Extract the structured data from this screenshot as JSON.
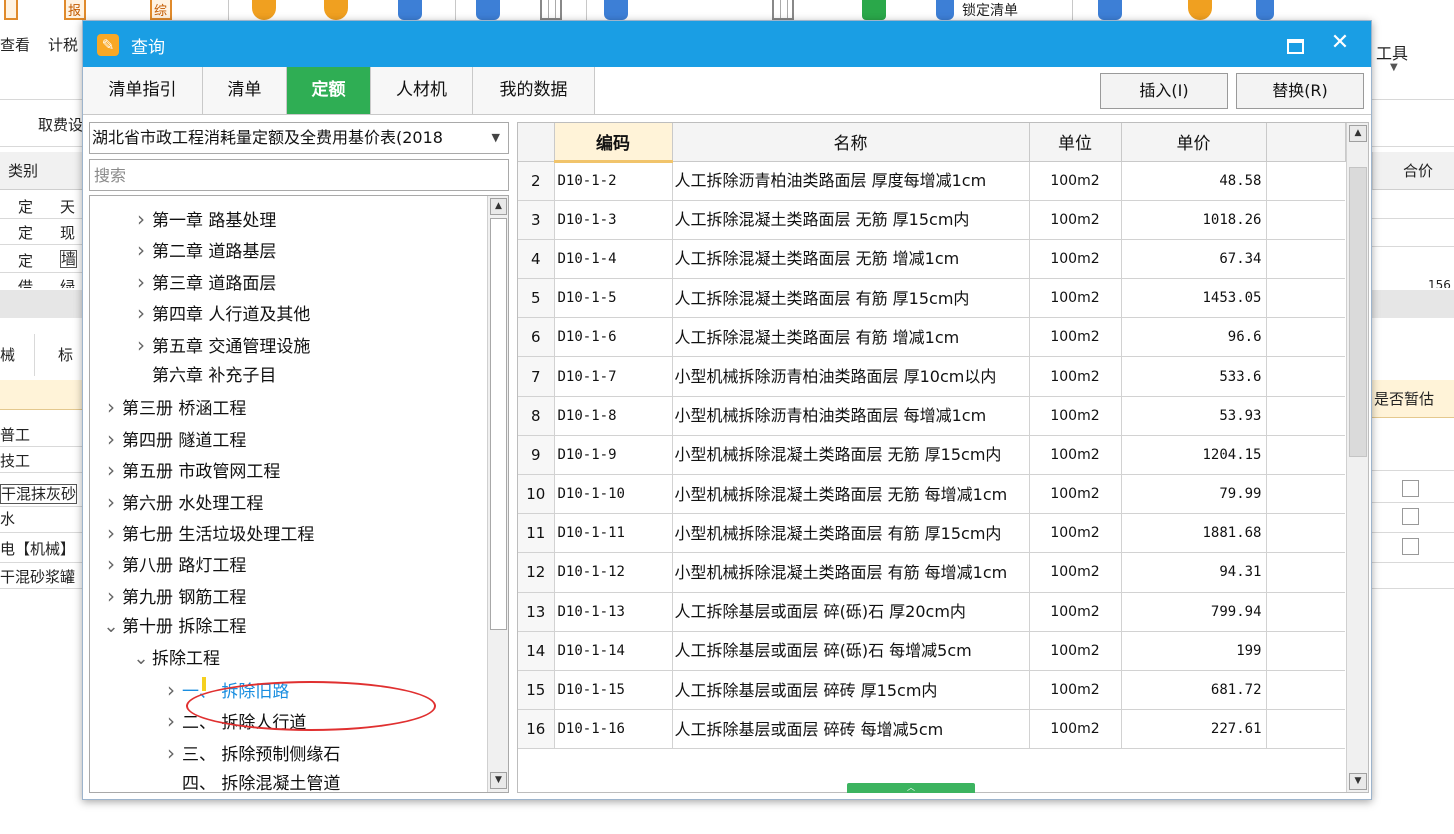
{
  "background": {
    "ribbon_top_texts": [
      "报",
      "综",
      "锁定清单"
    ],
    "ribbon_labels": [
      "查看",
      "计税"
    ],
    "tools_label": "工具",
    "fee_label": "取费设",
    "grid": {
      "category_header": "类别",
      "rows": [
        {
          "type": "定",
          "text": "天"
        },
        {
          "type": "定",
          "text": "现"
        },
        {
          "type": "定",
          "text": "墙"
        },
        {
          "type": "借",
          "text": "绿"
        }
      ],
      "total_header": "合价",
      "partial_value": "156"
    },
    "lower_tabs": [
      "械",
      "标"
    ],
    "resource_rows": [
      "普工",
      "技工",
      "干混抹灰砂",
      "水",
      "电【机械】",
      "干混砂浆罐"
    ],
    "provisional_header": "是否暂估"
  },
  "dialog": {
    "title": "查询",
    "tabs": [
      "清单指引",
      "清单",
      "定额",
      "人材机",
      "我的数据"
    ],
    "active_tab_index": 2,
    "insert_button": "插入(I)",
    "replace_button": "替换(R)",
    "library": "湖北省市政工程消耗量定额及全费用基价表(2018",
    "search_placeholder": "搜索",
    "tree": [
      {
        "label": "第一章 路基处理",
        "level": 1,
        "expander": "collapsed"
      },
      {
        "label": "第二章 道路基层",
        "level": 1,
        "expander": "collapsed"
      },
      {
        "label": "第三章 道路面层",
        "level": 1,
        "expander": "collapsed"
      },
      {
        "label": "第四章 人行道及其他",
        "level": 1,
        "expander": "collapsed"
      },
      {
        "label": "第五章 交通管理设施",
        "level": 1,
        "expander": "collapsed"
      },
      {
        "label": "第六章 补充子目",
        "level": 1,
        "expander": "none"
      },
      {
        "label": "第三册 桥涵工程",
        "level": 0,
        "expander": "collapsed"
      },
      {
        "label": "第四册 隧道工程",
        "level": 0,
        "expander": "collapsed"
      },
      {
        "label": "第五册 市政管网工程",
        "level": 0,
        "expander": "collapsed"
      },
      {
        "label": "第六册 水处理工程",
        "level": 0,
        "expander": "collapsed"
      },
      {
        "label": "第七册 生活垃圾处理工程",
        "level": 0,
        "expander": "collapsed"
      },
      {
        "label": "第八册 路灯工程",
        "level": 0,
        "expander": "collapsed"
      },
      {
        "label": "第九册 钢筋工程",
        "level": 0,
        "expander": "collapsed"
      },
      {
        "label": "第十册 拆除工程",
        "level": 0,
        "expander": "expanded"
      },
      {
        "label": "拆除工程",
        "level": 1,
        "expander": "expanded"
      },
      {
        "label": "一、 拆除旧路",
        "level": 2,
        "expander": "collapsed",
        "selected": true
      },
      {
        "label": "二、 拆除人行道",
        "level": 2,
        "expander": "collapsed"
      },
      {
        "label": "三、 拆除预制侧缘石",
        "level": 2,
        "expander": "collapsed"
      },
      {
        "label": "四、 拆除混凝土管道",
        "level": 2,
        "expander": "none"
      }
    ],
    "table": {
      "headers": {
        "code": "编码",
        "name": "名称",
        "unit": "单位",
        "price": "单价"
      },
      "rows": [
        {
          "no": "2",
          "code": "D10-1-2",
          "name": "人工拆除沥青柏油类路面层 厚度每增减1cm",
          "unit": "100m2",
          "price": "48.58"
        },
        {
          "no": "3",
          "code": "D10-1-3",
          "name": "人工拆除混凝土类路面层 无筋 厚15cm内",
          "unit": "100m2",
          "price": "1018.26"
        },
        {
          "no": "4",
          "code": "D10-1-4",
          "name": "人工拆除混凝土类路面层 无筋 增减1cm",
          "unit": "100m2",
          "price": "67.34"
        },
        {
          "no": "5",
          "code": "D10-1-5",
          "name": "人工拆除混凝土类路面层 有筋 厚15cm内",
          "unit": "100m2",
          "price": "1453.05"
        },
        {
          "no": "6",
          "code": "D10-1-6",
          "name": "人工拆除混凝土类路面层 有筋 增减1cm",
          "unit": "100m2",
          "price": "96.6"
        },
        {
          "no": "7",
          "code": "D10-1-7",
          "name": "小型机械拆除沥青柏油类路面层 厚10cm以内",
          "unit": "100m2",
          "price": "533.6"
        },
        {
          "no": "8",
          "code": "D10-1-8",
          "name": "小型机械拆除沥青柏油类路面层 每增减1cm",
          "unit": "100m2",
          "price": "53.93"
        },
        {
          "no": "9",
          "code": "D10-1-9",
          "name": "小型机械拆除混凝土类路面层 无筋 厚15cm内",
          "unit": "100m2",
          "price": "1204.15"
        },
        {
          "no": "10",
          "code": "D10-1-10",
          "name": "小型机械拆除混凝土类路面层 无筋 每增减1cm",
          "unit": "100m2",
          "price": "79.99"
        },
        {
          "no": "11",
          "code": "D10-1-11",
          "name": "小型机械拆除混凝土类路面层 有筋 厚15cm内",
          "unit": "100m2",
          "price": "1881.68"
        },
        {
          "no": "12",
          "code": "D10-1-12",
          "name": "小型机械拆除混凝土类路面层 有筋 每增减1cm",
          "unit": "100m2",
          "price": "94.31"
        },
        {
          "no": "13",
          "code": "D10-1-13",
          "name": "人工拆除基层或面层 碎(砾)石 厚20cm内",
          "unit": "100m2",
          "price": "799.94"
        },
        {
          "no": "14",
          "code": "D10-1-14",
          "name": "人工拆除基层或面层 碎(砾)石 每增减5cm",
          "unit": "100m2",
          "price": "199"
        },
        {
          "no": "15",
          "code": "D10-1-15",
          "name": "人工拆除基层或面层 碎砖 厚15cm内",
          "unit": "100m2",
          "price": "681.72"
        },
        {
          "no": "16",
          "code": "D10-1-16",
          "name": "人工拆除基层或面层 碎砖 每增减5cm",
          "unit": "100m2",
          "price": "227.61"
        }
      ]
    }
  },
  "colors": {
    "titlebar": "#1a9ee4",
    "active_tab": "#2fae54",
    "annotation": "#e03030",
    "selected_node": "#1a8ee0",
    "sorted_header": "#fff3d8"
  }
}
